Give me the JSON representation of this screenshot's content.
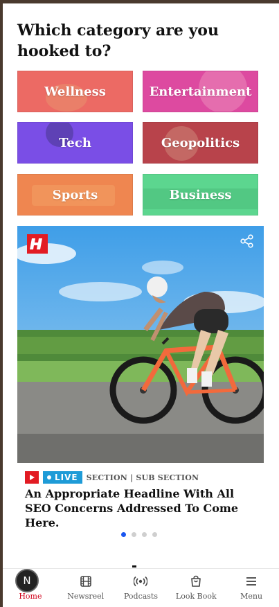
{
  "page": {
    "heading": "Which category are you hooked to?"
  },
  "categories": [
    {
      "label": "Wellness",
      "color": "#ec6a64"
    },
    {
      "label": "Entertainment",
      "color": "#dd4aa0"
    },
    {
      "label": "Tech",
      "color": "#7a4ee6"
    },
    {
      "label": "Geopolitics",
      "color": "#b8434b"
    },
    {
      "label": "Sports",
      "color": "#ef8650"
    },
    {
      "label": "Business",
      "color": "#5cd68f"
    }
  ],
  "featured": {
    "logo_icon": "brand-logo",
    "share_icon": "share-icon",
    "live_label": "LIVE",
    "section_label": "SECTION | SUB SECTION",
    "headline": "An Appropriate Headline With All SEO Concerns Addressed To Come Here."
  },
  "carousel": {
    "slides": 4,
    "active_index": 0,
    "active_color": "#1a56f0"
  },
  "bottom_nav": {
    "badge_letter": "N",
    "items": [
      {
        "label": "Home",
        "icon": "home-icon"
      },
      {
        "label": "Newsreel",
        "icon": "film-icon"
      },
      {
        "label": "Podcasts",
        "icon": "podcast-icon"
      },
      {
        "label": "Look Book",
        "icon": "bag-icon"
      },
      {
        "label": "Menu",
        "icon": "menu-icon"
      }
    ]
  }
}
